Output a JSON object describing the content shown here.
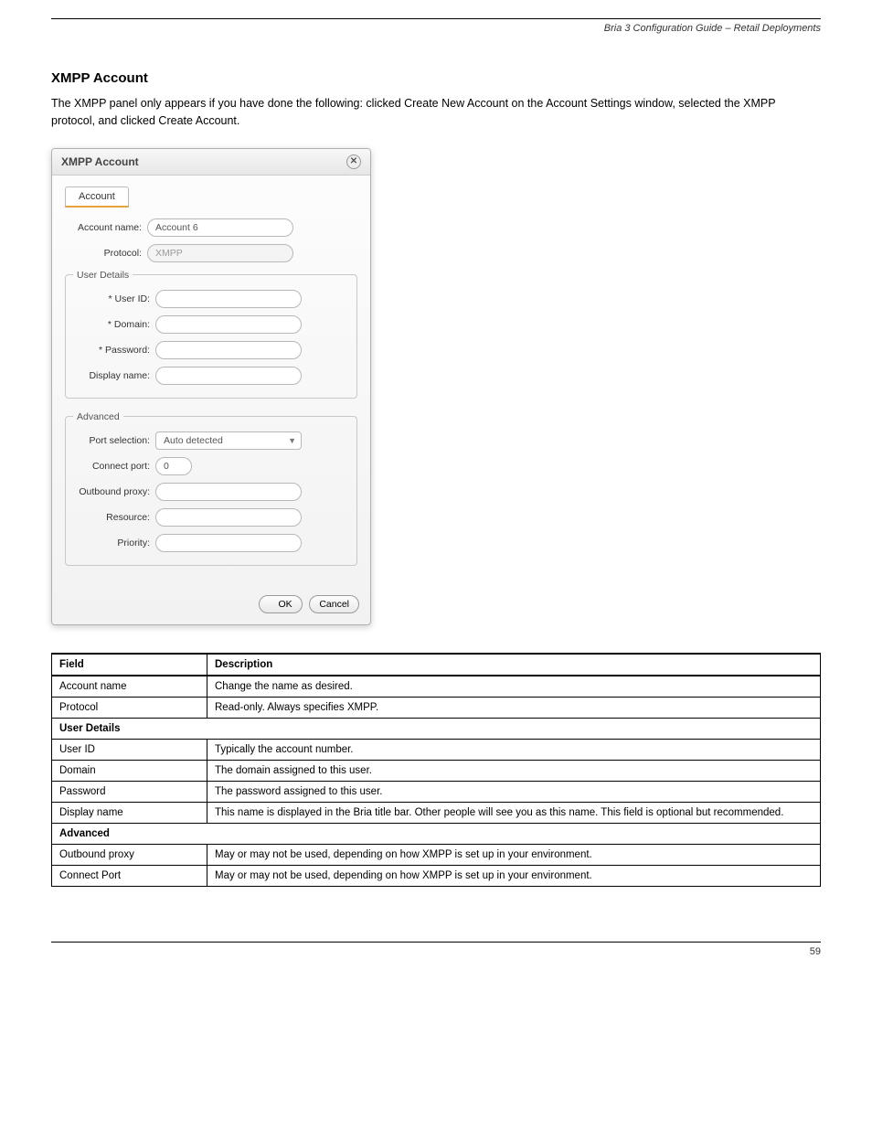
{
  "header": {
    "running_title": "Bria 3 Configuration Guide – Retail Deployments"
  },
  "section": {
    "heading": "XMPP Account",
    "paragraph": "The XMPP panel only appears if you have done the following: clicked Create New Account on the Account Settings window, selected the XMPP protocol, and clicked Create Account."
  },
  "dialog": {
    "title": "XMPP Account",
    "tab": "Account",
    "labels": {
      "account_name": "Account name:",
      "protocol": "Protocol:",
      "user_id": "* User ID:",
      "domain": "* Domain:",
      "password": "* Password:",
      "display_name": "Display name:",
      "port_selection": "Port selection:",
      "connect_port": "Connect port:",
      "outbound_proxy": "Outbound proxy:",
      "resource": "Resource:",
      "priority": "Priority:"
    },
    "values": {
      "account_name": "Account 6",
      "protocol": "XMPP",
      "port_selection": "Auto detected",
      "connect_port": "0"
    },
    "groups": {
      "user_details": "User Details",
      "advanced": "Advanced"
    },
    "buttons": {
      "ok": "OK",
      "cancel": "Cancel"
    }
  },
  "table": {
    "head": {
      "field": "Field",
      "description": "Description"
    },
    "rows": [
      {
        "field": "Account name",
        "desc": "Change the name as desired."
      },
      {
        "field": "Protocol",
        "desc": "Read-only. Always specifies XMPP."
      }
    ],
    "section_user": "User Details",
    "user_rows": [
      {
        "field": "User ID",
        "desc": "Typically the account number."
      },
      {
        "field": "Domain",
        "desc": "The domain assigned to this user."
      },
      {
        "field": "Password",
        "desc": "The password assigned to this user."
      },
      {
        "field": "Display name",
        "desc": "This name is displayed in the Bria title bar. Other people will see you as this name. This field is optional but recommended."
      }
    ],
    "section_advanced": "Advanced",
    "advanced_rows": [
      {
        "field": "Outbound proxy",
        "desc": "May or may not be used, depending on how XMPP is set up in your environment."
      },
      {
        "field": "Connect Port",
        "desc": "May or may not be used, depending on how XMPP is set up in your environment."
      }
    ]
  },
  "footer": {
    "page": "59"
  }
}
